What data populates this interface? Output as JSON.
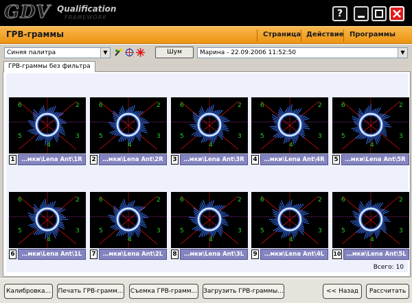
{
  "app": {
    "logo": "GDV",
    "logo_sub": "Qualification",
    "logo_sub2": "FRAMEWORK"
  },
  "header": {
    "title": "ГРВ-граммы",
    "menu": [
      "Страница",
      "Действие",
      "Программы"
    ]
  },
  "toolbar": {
    "palette_value": "Синяя палитра",
    "noise_label": "Шум",
    "session_value": "Марина - 22.09.2006 11:52:50"
  },
  "tab": {
    "label": "ГРВ-граммы без фильтра"
  },
  "tiles": [
    {
      "number": "1",
      "label": "…мки\\Lena Ant\\1R"
    },
    {
      "number": "2",
      "label": "…мки\\Lena Ant\\2R"
    },
    {
      "number": "3",
      "label": "…мки\\Lena Ant\\3R"
    },
    {
      "number": "4",
      "label": "…мки\\Lena Ant\\4R"
    },
    {
      "number": "5",
      "label": "…мки\\Lena Ant\\5R"
    },
    {
      "number": "6",
      "label": "…мки\\Lena Ant\\1L"
    },
    {
      "number": "7",
      "label": "…мки\\Lena Ant\\2L"
    },
    {
      "number": "8",
      "label": "…мки\\Lena Ant\\3L"
    },
    {
      "number": "9",
      "label": "…мки\\Lena Ant\\4L"
    },
    {
      "number": "10",
      "label": "…мки\\Lena Ant\\5L"
    }
  ],
  "sector_labels": [
    "6",
    "2",
    "5",
    "3",
    "4"
  ],
  "total": "Всего: 10",
  "buttons": {
    "calibration": "Калибровка...",
    "print": "Печать ГРВ-грамм...",
    "shoot": "Съемка ГРВ-грамм...",
    "load": "Загрузить ГРВ-граммы...",
    "back": "<< Назад",
    "calculate": "Рассчитать"
  },
  "colors": {
    "header_orange": "#f0a020",
    "glow_blue": "#3a78ff",
    "sector_line_red": "#e01010",
    "sector_label_green": "#28d028",
    "label_bg": "#8484c0"
  },
  "icons": [
    "help-icon",
    "minimize-icon",
    "maximize-icon",
    "close-icon",
    "palette-icon",
    "target-icon",
    "asterisk-icon",
    "dropdown-arrow-icon"
  ]
}
